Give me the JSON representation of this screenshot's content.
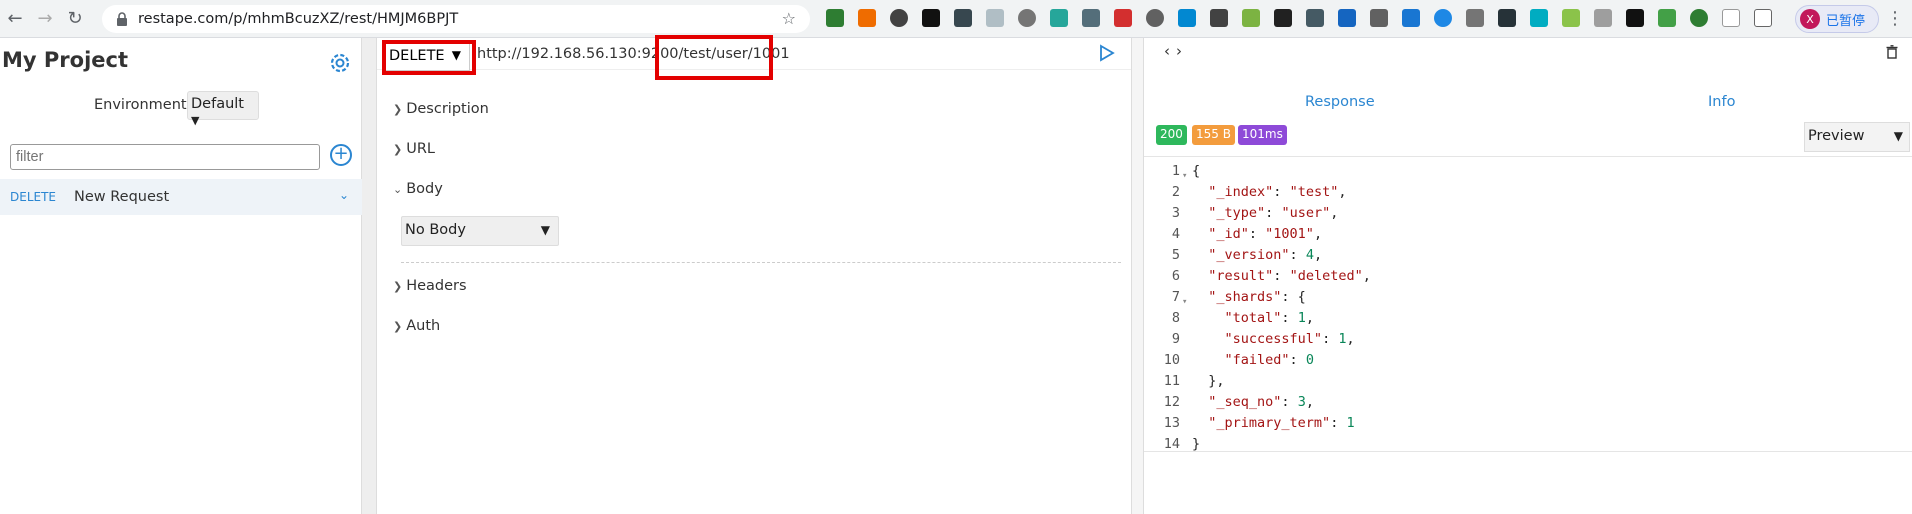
{
  "browser": {
    "url": "restape.com/p/mhmBcuzXZ/rest/HMJM6BPJT",
    "profile_initial": "X",
    "profile_label": "已暂停"
  },
  "sidebar": {
    "title": "My Project",
    "env_label": "Environment",
    "env_value": "Default",
    "filter_placeholder": "filter",
    "item_method": "DELETE",
    "item_name": "New Request"
  },
  "request": {
    "method": "DELETE",
    "url": "http://192.168.56.130:9200/test/user/1001",
    "sections": {
      "description": "Description",
      "url": "URL",
      "body": "Body",
      "headers": "Headers",
      "auth": "Auth"
    },
    "body_type": "No Body"
  },
  "response": {
    "tab_response": "Response",
    "tab_info": "Info",
    "status": "200",
    "size": "155 B",
    "time": "101ms",
    "view_mode": "Preview",
    "line_numbers": [
      "1",
      "2",
      "3",
      "4",
      "5",
      "6",
      "7",
      "8",
      "9",
      "10",
      "11",
      "12",
      "13",
      "14"
    ],
    "lines": [
      "{",
      "  \"_index\": \"test\",",
      "  \"_type\": \"user\",",
      "  \"_id\": \"1001\",",
      "  \"_version\": 4,",
      "  \"result\": \"deleted\",",
      "  \"_shards\": {",
      "    \"total\": 1,",
      "    \"successful\": 1,",
      "    \"failed\": 0",
      "  },",
      "  \"_seq_no\": 3,",
      "  \"_primary_term\": 1",
      "}"
    ]
  },
  "colors": {
    "status": "#2eb85c",
    "size": "#f39c3d",
    "time": "#8e4ad8",
    "accent": "#2b86d1",
    "highlight": "#e30000"
  }
}
